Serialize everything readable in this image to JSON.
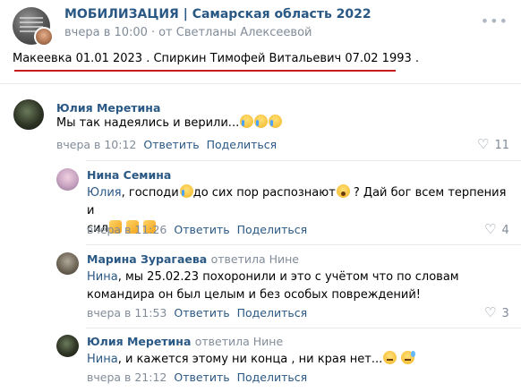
{
  "post": {
    "group_title": "МОБИЛИЗАЦИЯ | Самарская область 2022",
    "time": "вчера в 10:00",
    "author": "от Светланы Алексеевой",
    "text": "Макеевка 01.01 2023 . Спиркин Тимофей Витальевич 07.02 1993 ."
  },
  "labels": {
    "reply": "Ответить",
    "share": "Поделиться"
  },
  "comments": [
    {
      "name": "Юлия Меретина",
      "text": "Мы так надеялись и верили...",
      "time": "вчера в 10:12",
      "likes": "11"
    },
    {
      "name": "Нина Семина",
      "addressee": "Юлия",
      "text_1": ", господи",
      "text_2": "до сих пор распознают",
      "text_3": " ? Дай бог всем терпения и",
      "text_4": "сил",
      "time": "вчера в 11:26",
      "likes": "4"
    },
    {
      "name": "Марина Зурагаева",
      "reply_to": "ответила Нине",
      "addressee": "Нина",
      "text_line1": ", мы 25.02.23 похоронили и это с учётом что по словам",
      "text_line2": "командира он был целым и без особых повреждений!",
      "time": "вчера в 11:53",
      "likes": "3"
    },
    {
      "name": "Юлия Меретина",
      "reply_to": "ответила Нине",
      "addressee": "Нина",
      "text": ", и кажется этому ни конца , ни края нет...",
      "time": "вчера в 21:12"
    }
  ],
  "colors": {
    "link": "#2a5885",
    "meta": "#818c99",
    "underline": "#c81c1c"
  },
  "icons": {
    "more": "more-horizontal-icon",
    "like": "heart-icon"
  }
}
